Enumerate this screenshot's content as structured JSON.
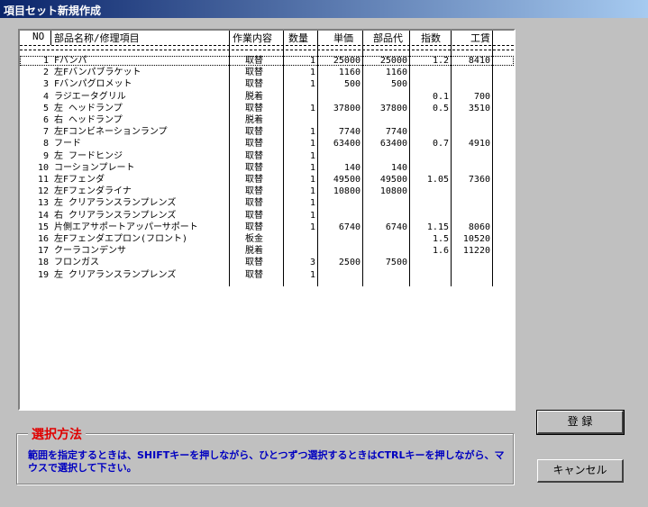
{
  "window": {
    "title": "項目セット新規作成"
  },
  "table": {
    "headers": {
      "no": "NO",
      "name": "部品名称/修理項目",
      "work": "作業内容",
      "qty": "数量",
      "unit": "単価",
      "parts": "部品代",
      "index": "指数",
      "labor": "工賃"
    },
    "rows": [
      {
        "no": "1",
        "name": "Fバンパ",
        "work": "取替",
        "qty": "1",
        "unit": "25000",
        "parts": "25000",
        "index": "1.2",
        "labor": "8410"
      },
      {
        "no": "2",
        "name": "    左Fバンパブラケット",
        "work": "取替",
        "qty": "1",
        "unit": "1160",
        "parts": "1160",
        "index": "",
        "labor": ""
      },
      {
        "no": "3",
        "name": "   Fバンパグロメット",
        "work": "取替",
        "qty": "1",
        "unit": "500",
        "parts": "500",
        "index": "",
        "labor": ""
      },
      {
        "no": "4",
        "name": "ラジエータグリル",
        "work": "脱着",
        "qty": "",
        "unit": "",
        "parts": "",
        "index": "0.1",
        "labor": "700"
      },
      {
        "no": "5",
        "name": "左 ヘッドランプ",
        "work": "取替",
        "qty": "1",
        "unit": "37800",
        "parts": "37800",
        "index": "0.5",
        "labor": "3510"
      },
      {
        "no": "6",
        "name": "     右 ヘッドランプ",
        "work": "脱着",
        "qty": "",
        "unit": "",
        "parts": "",
        "index": "",
        "labor": ""
      },
      {
        "no": "7",
        "name": "    左Fコンビネーションランプ",
        "work": "取替",
        "qty": "1",
        "unit": "7740",
        "parts": "7740",
        "index": "",
        "labor": ""
      },
      {
        "no": "8",
        "name": "フード",
        "work": "取替",
        "qty": "1",
        "unit": "63400",
        "parts": "63400",
        "index": "0.7",
        "labor": "4910"
      },
      {
        "no": "9",
        "name": "左 フードヒンジ",
        "work": "取替",
        "qty": "1",
        "unit": "",
        "parts": "",
        "index": "",
        "labor": ""
      },
      {
        "no": "10",
        "name": "    コーションプレート",
        "work": "取替",
        "qty": "1",
        "unit": "140",
        "parts": "140",
        "index": "",
        "labor": ""
      },
      {
        "no": "11",
        "name": "左Fフェンダ",
        "work": "取替",
        "qty": "1",
        "unit": "49500",
        "parts": "49500",
        "index": "1.05",
        "labor": "7360"
      },
      {
        "no": "12",
        "name": "     左Fフェンダライナ",
        "work": "取替",
        "qty": "1",
        "unit": "10800",
        "parts": "10800",
        "index": "",
        "labor": ""
      },
      {
        "no": "13",
        "name": "左 クリアランスランプレンズ",
        "work": "取替",
        "qty": "1",
        "unit": "",
        "parts": "",
        "index": "",
        "labor": ""
      },
      {
        "no": "14",
        "name": "右 クリアランスランプレンズ",
        "work": "取替",
        "qty": "1",
        "unit": "",
        "parts": "",
        "index": "",
        "labor": ""
      },
      {
        "no": "15",
        "name": "片側エアサポートアッパーサポート",
        "work": "取替",
        "qty": "1",
        "unit": "6740",
        "parts": "6740",
        "index": "1.15",
        "labor": "8060"
      },
      {
        "no": "16",
        "name": "左Fフェンダエプロン(フロント)",
        "work": "板金",
        "qty": "",
        "unit": "",
        "parts": "",
        "index": "1.5",
        "labor": "10520"
      },
      {
        "no": "17",
        "name": "クーラコンデンサ",
        "work": "脱着",
        "qty": "",
        "unit": "",
        "parts": "",
        "index": "1.6",
        "labor": "11220"
      },
      {
        "no": "18",
        "name": "     フロンガス",
        "work": "取替",
        "qty": "3",
        "unit": "2500",
        "parts": "7500",
        "index": "",
        "labor": ""
      },
      {
        "no": "19",
        "name": "左 クリアランスランプレンズ",
        "work": "取替",
        "qty": "1",
        "unit": "",
        "parts": "",
        "index": "",
        "labor": ""
      }
    ]
  },
  "selection_info": {
    "title": "選択方法",
    "text": "範囲を指定するときは、SHIFTキーを押しながら、ひとつずつ選択するときはCTRLキーを押しながら、マウスで選択して下さい。"
  },
  "buttons": {
    "register": "登 録",
    "cancel": "キャンセル"
  }
}
